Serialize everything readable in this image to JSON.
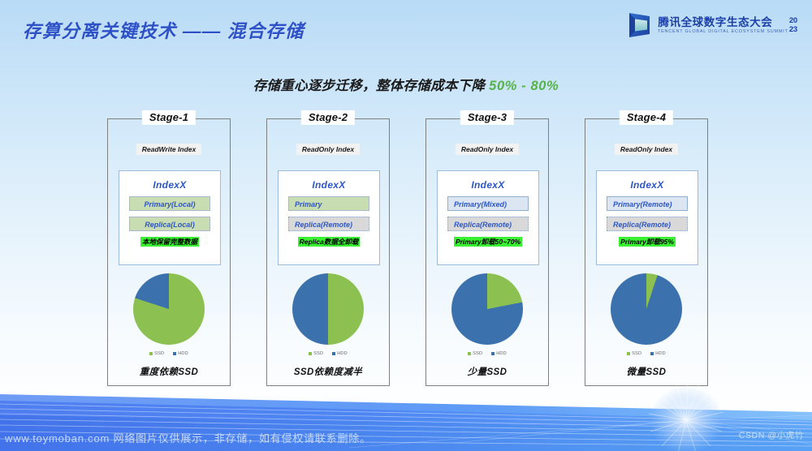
{
  "header": {
    "title": "存算分离关键技术 —— 混合存储",
    "logo": {
      "cn": "腾讯全球数字生态大会",
      "en": "TENCENT GLOBAL DIGITAL ECOSYSTEM SUMMIT",
      "year_top": "20",
      "year_bottom": "23"
    }
  },
  "subtitle": {
    "text": "存储重心逐步迁移，整体存储成本下降 ",
    "highlight": "50% - 80%",
    "highlight_color": "#57b24a"
  },
  "legend": {
    "ssd_label": "SSD",
    "hdd_label": "HDD",
    "ssd_color": "#8cc152",
    "hdd_color": "#3b72ad"
  },
  "stages": [
    {
      "title": "Stage-1",
      "index_kind": "ReadWrite Index",
      "index_name": "IndexX",
      "primary": "Primary(Local)",
      "replica": "Replica(Local)",
      "note": "本地保留完整数据",
      "caption": "重度依赖SSD"
    },
    {
      "title": "Stage-2",
      "index_kind": "ReadOnly Index",
      "index_name": "IndexX",
      "primary": "Primary",
      "replica": "Replica(Remote)",
      "note": "Replica数据全卸载",
      "caption": "SSD依赖度减半"
    },
    {
      "title": "Stage-3",
      "index_kind": "ReadOnly Index",
      "index_name": "IndexX",
      "primary": "Primary(Mixed)",
      "replica": "Replica(Remote)",
      "note": "Primary卸载50~70%",
      "caption": "少量SSD"
    },
    {
      "title": "Stage-4",
      "index_kind": "ReadOnly Index",
      "index_name": "IndexX",
      "primary": "Primary(Remote)",
      "replica": "Replica(Remote)",
      "note": "Primary卸载95%",
      "caption": "微量SSD"
    }
  ],
  "chart_data": [
    {
      "type": "pie",
      "title": "重度依赖SSD",
      "categories": [
        "SSD",
        "HDD"
      ],
      "values": [
        80,
        20
      ],
      "colors": [
        "#8cc152",
        "#3b72ad"
      ],
      "legend_position": "bottom",
      "start_angle": 0
    },
    {
      "type": "pie",
      "title": "SSD依赖度减半",
      "categories": [
        "SSD",
        "HDD"
      ],
      "values": [
        50,
        50
      ],
      "colors": [
        "#8cc152",
        "#3b72ad"
      ],
      "legend_position": "bottom",
      "start_angle": 0
    },
    {
      "type": "pie",
      "title": "少量SSD",
      "categories": [
        "SSD",
        "HDD"
      ],
      "values": [
        22,
        78
      ],
      "colors": [
        "#8cc152",
        "#3b72ad"
      ],
      "legend_position": "bottom",
      "start_angle": 0
    },
    {
      "type": "pie",
      "title": "微量SSD",
      "categories": [
        "SSD",
        "HDD"
      ],
      "values": [
        5,
        95
      ],
      "colors": [
        "#8cc152",
        "#3b72ad"
      ],
      "legend_position": "bottom",
      "start_angle": 0
    }
  ],
  "watermarks": {
    "bottom": "www.toymoban.com 网络图片仅供展示，非存储，如有侵权请联系删除。",
    "corner": "CSDN @小虎竹"
  }
}
